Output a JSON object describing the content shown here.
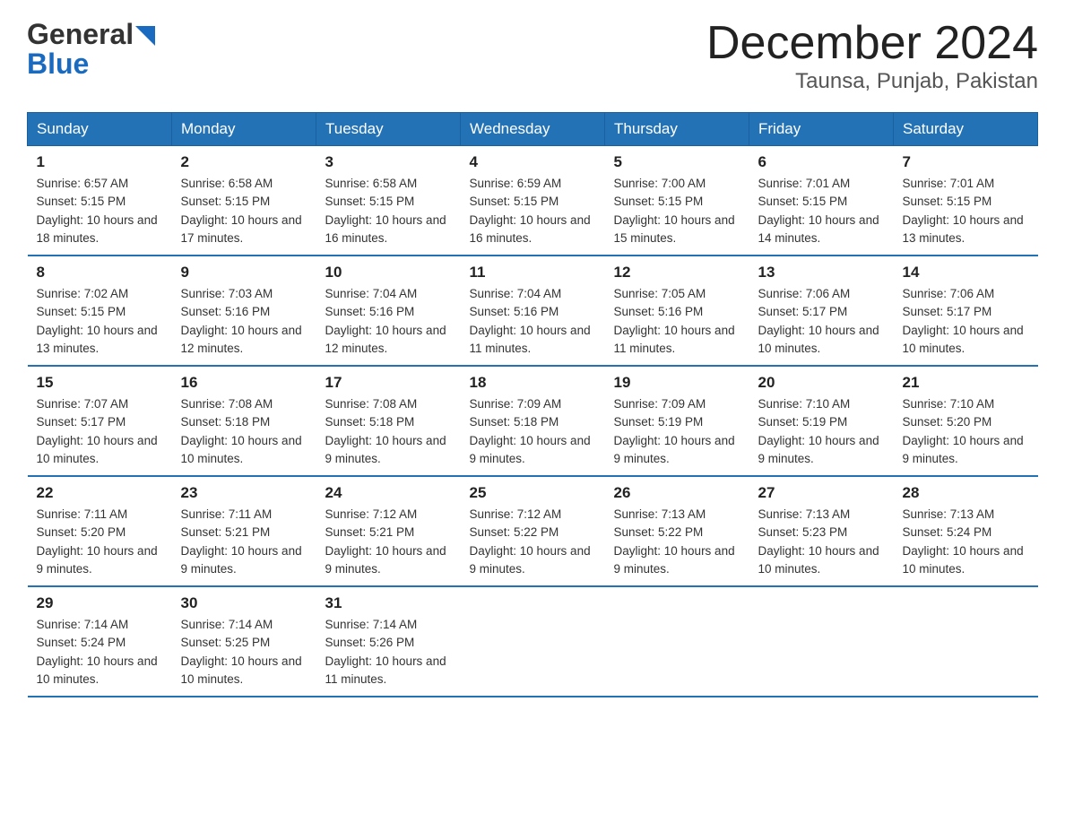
{
  "logo": {
    "line1": "General",
    "line2": "Blue"
  },
  "title": "December 2024",
  "subtitle": "Taunsa, Punjab, Pakistan",
  "days_of_week": [
    "Sunday",
    "Monday",
    "Tuesday",
    "Wednesday",
    "Thursday",
    "Friday",
    "Saturday"
  ],
  "weeks": [
    [
      {
        "num": "1",
        "sunrise": "6:57 AM",
        "sunset": "5:15 PM",
        "daylight": "10 hours and 18 minutes."
      },
      {
        "num": "2",
        "sunrise": "6:58 AM",
        "sunset": "5:15 PM",
        "daylight": "10 hours and 17 minutes."
      },
      {
        "num": "3",
        "sunrise": "6:58 AM",
        "sunset": "5:15 PM",
        "daylight": "10 hours and 16 minutes."
      },
      {
        "num": "4",
        "sunrise": "6:59 AM",
        "sunset": "5:15 PM",
        "daylight": "10 hours and 16 minutes."
      },
      {
        "num": "5",
        "sunrise": "7:00 AM",
        "sunset": "5:15 PM",
        "daylight": "10 hours and 15 minutes."
      },
      {
        "num": "6",
        "sunrise": "7:01 AM",
        "sunset": "5:15 PM",
        "daylight": "10 hours and 14 minutes."
      },
      {
        "num": "7",
        "sunrise": "7:01 AM",
        "sunset": "5:15 PM",
        "daylight": "10 hours and 13 minutes."
      }
    ],
    [
      {
        "num": "8",
        "sunrise": "7:02 AM",
        "sunset": "5:15 PM",
        "daylight": "10 hours and 13 minutes."
      },
      {
        "num": "9",
        "sunrise": "7:03 AM",
        "sunset": "5:16 PM",
        "daylight": "10 hours and 12 minutes."
      },
      {
        "num": "10",
        "sunrise": "7:04 AM",
        "sunset": "5:16 PM",
        "daylight": "10 hours and 12 minutes."
      },
      {
        "num": "11",
        "sunrise": "7:04 AM",
        "sunset": "5:16 PM",
        "daylight": "10 hours and 11 minutes."
      },
      {
        "num": "12",
        "sunrise": "7:05 AM",
        "sunset": "5:16 PM",
        "daylight": "10 hours and 11 minutes."
      },
      {
        "num": "13",
        "sunrise": "7:06 AM",
        "sunset": "5:17 PM",
        "daylight": "10 hours and 10 minutes."
      },
      {
        "num": "14",
        "sunrise": "7:06 AM",
        "sunset": "5:17 PM",
        "daylight": "10 hours and 10 minutes."
      }
    ],
    [
      {
        "num": "15",
        "sunrise": "7:07 AM",
        "sunset": "5:17 PM",
        "daylight": "10 hours and 10 minutes."
      },
      {
        "num": "16",
        "sunrise": "7:08 AM",
        "sunset": "5:18 PM",
        "daylight": "10 hours and 10 minutes."
      },
      {
        "num": "17",
        "sunrise": "7:08 AM",
        "sunset": "5:18 PM",
        "daylight": "10 hours and 9 minutes."
      },
      {
        "num": "18",
        "sunrise": "7:09 AM",
        "sunset": "5:18 PM",
        "daylight": "10 hours and 9 minutes."
      },
      {
        "num": "19",
        "sunrise": "7:09 AM",
        "sunset": "5:19 PM",
        "daylight": "10 hours and 9 minutes."
      },
      {
        "num": "20",
        "sunrise": "7:10 AM",
        "sunset": "5:19 PM",
        "daylight": "10 hours and 9 minutes."
      },
      {
        "num": "21",
        "sunrise": "7:10 AM",
        "sunset": "5:20 PM",
        "daylight": "10 hours and 9 minutes."
      }
    ],
    [
      {
        "num": "22",
        "sunrise": "7:11 AM",
        "sunset": "5:20 PM",
        "daylight": "10 hours and 9 minutes."
      },
      {
        "num": "23",
        "sunrise": "7:11 AM",
        "sunset": "5:21 PM",
        "daylight": "10 hours and 9 minutes."
      },
      {
        "num": "24",
        "sunrise": "7:12 AM",
        "sunset": "5:21 PM",
        "daylight": "10 hours and 9 minutes."
      },
      {
        "num": "25",
        "sunrise": "7:12 AM",
        "sunset": "5:22 PM",
        "daylight": "10 hours and 9 minutes."
      },
      {
        "num": "26",
        "sunrise": "7:13 AM",
        "sunset": "5:22 PM",
        "daylight": "10 hours and 9 minutes."
      },
      {
        "num": "27",
        "sunrise": "7:13 AM",
        "sunset": "5:23 PM",
        "daylight": "10 hours and 10 minutes."
      },
      {
        "num": "28",
        "sunrise": "7:13 AM",
        "sunset": "5:24 PM",
        "daylight": "10 hours and 10 minutes."
      }
    ],
    [
      {
        "num": "29",
        "sunrise": "7:14 AM",
        "sunset": "5:24 PM",
        "daylight": "10 hours and 10 minutes."
      },
      {
        "num": "30",
        "sunrise": "7:14 AM",
        "sunset": "5:25 PM",
        "daylight": "10 hours and 10 minutes."
      },
      {
        "num": "31",
        "sunrise": "7:14 AM",
        "sunset": "5:26 PM",
        "daylight": "10 hours and 11 minutes."
      },
      null,
      null,
      null,
      null
    ]
  ],
  "labels": {
    "sunrise": "Sunrise:",
    "sunset": "Sunset:",
    "daylight": "Daylight:"
  }
}
